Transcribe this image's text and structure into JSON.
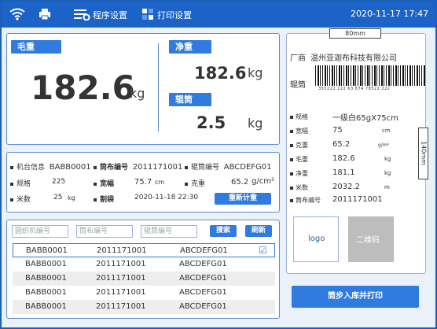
{
  "header": {
    "datetime": "2020-11-17  17:47",
    "program_settings": "程序设置",
    "print_settings": "打印设置"
  },
  "weights": {
    "gross_label": "毛重",
    "gross_value": "182.6",
    "gross_unit": "kg",
    "net_label": "净重",
    "net_value": "182.6",
    "net_unit": "kg",
    "tube_label": "辊筒",
    "tube_value": "2.5",
    "tube_unit": "kg"
  },
  "info": {
    "machine_label": "机台信息",
    "machine_value": "BABB0001",
    "cloth_no_label": "筒布编号",
    "cloth_no_value": "2011171001",
    "roller_no_label": "辊筒编号",
    "roller_no_value": "ABCDEFG01",
    "spec_label": "规格",
    "spec_value": "225",
    "width_label": "宽幅",
    "width_value": "75.7",
    "width_unit": "cm",
    "gram_label": "克重",
    "gram_value": "65.2",
    "gram_unit": "g/cm²",
    "meters_label": "米数",
    "meters_value": "25",
    "meters_unit": "kg",
    "cut_label": "割袋",
    "cut_value": "2020-11-18 22:30",
    "recount_button": "重新计重"
  },
  "search": {
    "machine_placeholder": "圆织机编号",
    "cloth_placeholder": "筒布编号",
    "roller_placeholder": "辊筒编号",
    "search_button": "搜索",
    "refresh_button": "刷新"
  },
  "table": {
    "rows": [
      {
        "machine": "BABB0001",
        "cloth": "2011171001",
        "roller": "ABCDEFG01",
        "checked": "☑"
      },
      {
        "machine": "BABB0001",
        "cloth": "2011171001",
        "roller": "ABCDEFG01",
        "checked": ""
      },
      {
        "machine": "BABB0001",
        "cloth": "2011171001",
        "roller": "ABCDEFG01",
        "checked": ""
      },
      {
        "machine": "BABB0001",
        "cloth": "2011171001",
        "roller": "ABCDEFG01",
        "checked": ""
      },
      {
        "machine": "BABB0001",
        "cloth": "2011171001",
        "roller": "ABCDEFG01",
        "checked": ""
      }
    ]
  },
  "label": {
    "width_dim": "80mm",
    "height_dim": "140mm",
    "factory_label": "厂商",
    "factory_value": "温州亚迦布科技有限公司",
    "roller_label": "辊筒",
    "barcode_text": "355222 222 63 874 78522 222",
    "spec_label": "规格",
    "spec_value": "一级白65gX75cm",
    "width_label": "宽幅",
    "width_value": "75",
    "width_unit": "cm",
    "gram_label": "克重",
    "gram_value": "65.2",
    "gram_unit": "g/m²",
    "gross_label": "毛重",
    "gross_value": "182.6",
    "gross_unit": "kg",
    "net_label": "净重",
    "net_value": "181.1",
    "net_unit": "kg",
    "meters_label": "米数",
    "meters_value": "2032.2",
    "meters_unit": "m",
    "cloth_no_label": "筒布编号",
    "cloth_no_value": "2011171001",
    "logo_text": "logo",
    "qr_text": "二维码"
  },
  "actions": {
    "store_print_button": "筒步入库并打印"
  },
  "colors": {
    "header_blue": "#1c63c7",
    "accent_blue": "#2f7be0",
    "row_alt": "#eeeeee"
  }
}
